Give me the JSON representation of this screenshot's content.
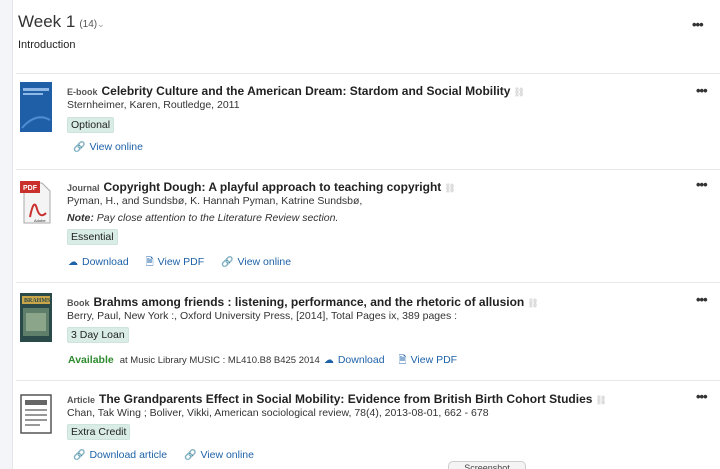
{
  "week": {
    "title": "Week 1",
    "count": "(14)",
    "caret": "⌄",
    "subtitle": "Introduction",
    "menu": "•••"
  },
  "items": [
    {
      "type": "E-book",
      "title": "Celebrity Culture and the American Dream: Stardom and Social Mobility",
      "meta": "Sternheimer, Karen, Routledge, 2011",
      "tag": "Optional",
      "actions": [
        {
          "icon": "link-icon",
          "label": "View online"
        }
      ],
      "menu": "•••"
    },
    {
      "type": "Journal",
      "title": "Copyright Dough: A playful approach to teaching copyright",
      "meta": "Pyman, H., and Sundsbø, K. Hannah Pyman, Katrine Sundsbø,",
      "note_label": "Note:",
      "note_text": " Pay close attention to the Literature Review section.",
      "tag": "Essential",
      "actions": [
        {
          "icon": "cloud-download-icon",
          "label": "Download"
        },
        {
          "icon": "pdf-icon",
          "label": "View PDF"
        },
        {
          "icon": "link-icon",
          "label": "View online"
        }
      ],
      "menu": "•••"
    },
    {
      "type": "Book",
      "title": "Brahms among friends : listening, performance, and the rhetoric of allusion",
      "meta": "Berry, Paul, New York :, Oxford University Press, [2014], Total Pages ix, 389 pages :",
      "tag": "3 Day Loan",
      "availability": "Available",
      "location": "at Music Library MUSIC : ML410.B8 B425 2014",
      "actions": [
        {
          "icon": "cloud-download-icon",
          "label": "Download"
        },
        {
          "icon": "pdf-icon",
          "label": "View PDF"
        }
      ],
      "menu": "•••"
    },
    {
      "type": "Article",
      "title": "The Grandparents Effect in Social Mobility: Evidence from British Birth Cohort Studies",
      "meta": "Chan, Tak Wing ; Boliver, Vikki, American sociological review, 78(4), 2013-08-01, 662 - 678",
      "tag": "Extra Credit",
      "actions": [
        {
          "icon": "link-icon",
          "label": "Download article"
        },
        {
          "icon": "link-icon",
          "label": "View online"
        }
      ],
      "menu": "•••"
    }
  ],
  "icons": {
    "link": "🔗",
    "cloud": "☁",
    "pdf": "🗎"
  },
  "colors": {
    "link": "#1e62a8",
    "available": "#2e8b2e",
    "tag_bg": "#d9ede6"
  },
  "screenshot_tab": "Screenshot"
}
